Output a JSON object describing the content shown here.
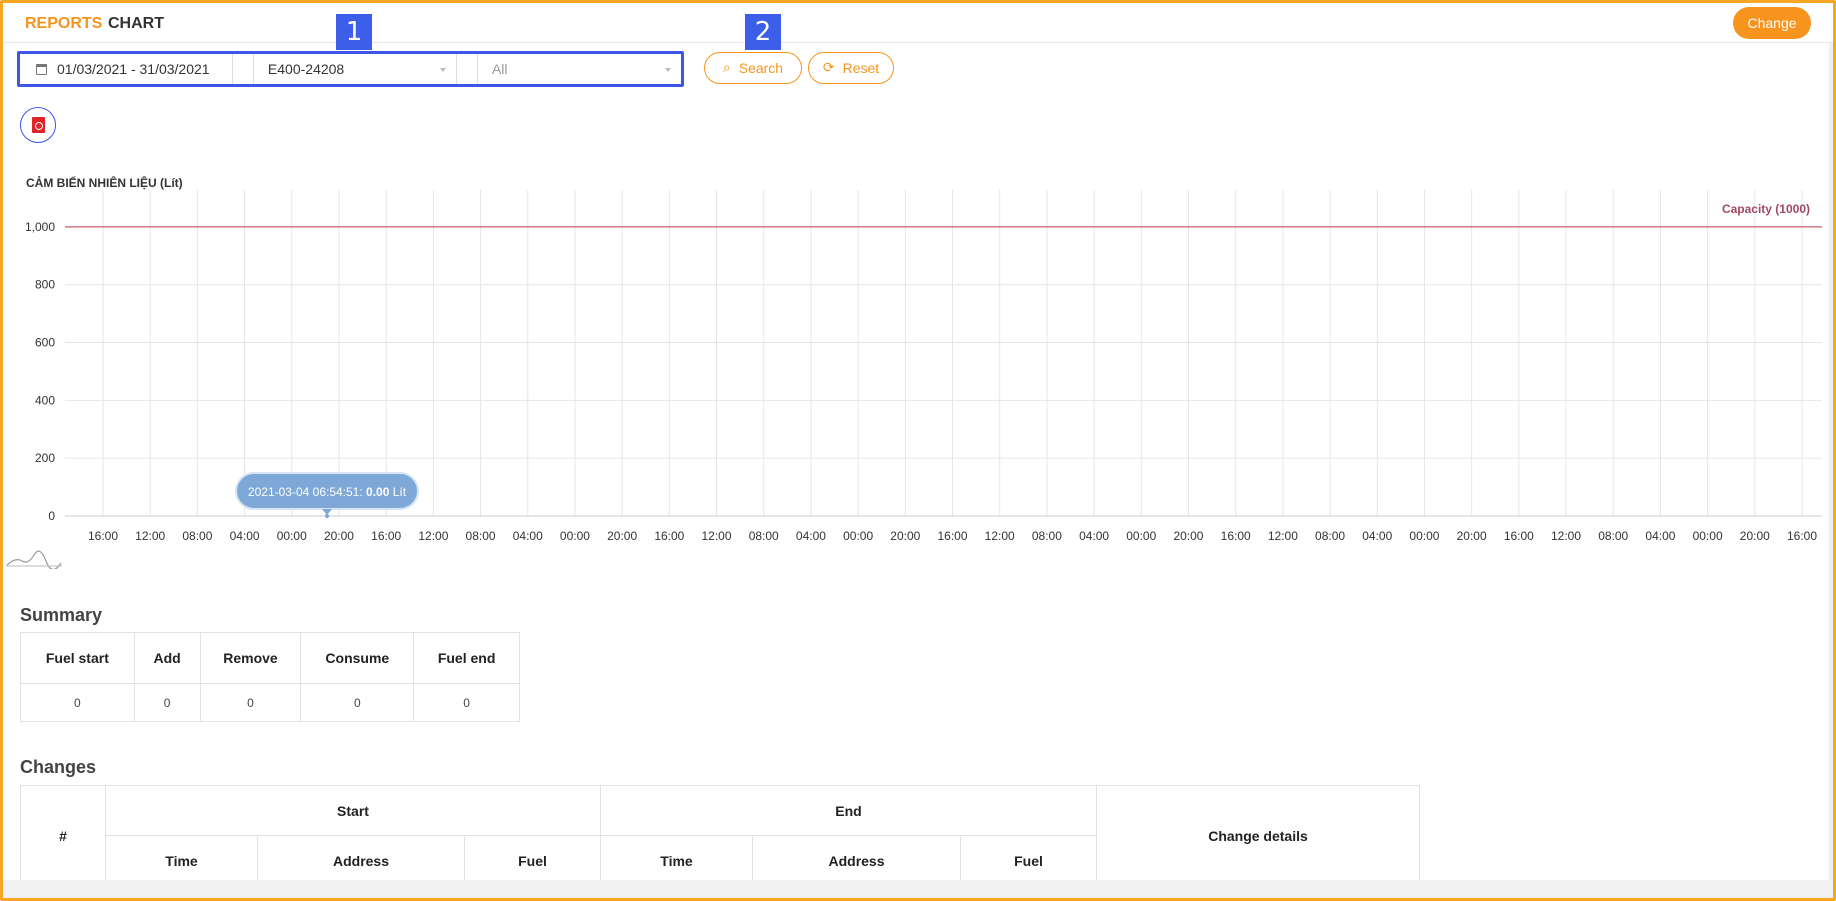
{
  "header": {
    "breadcrumb_reports": "REPORTS",
    "breadcrumb_chart": "CHART",
    "change_button": "Change"
  },
  "filters": {
    "date_range": "01/03/2021 - 31/03/2021",
    "vehicle": "E400-24208",
    "sensor": "All"
  },
  "markers": {
    "one": "1",
    "two": "2"
  },
  "actions": {
    "search": "Search",
    "reset": "Reset"
  },
  "chart_data": {
    "type": "line",
    "title": "CẢM BIẾN NHIÊN LIỆU (Lít)",
    "y_ticks": [
      "0",
      "200",
      "400",
      "600",
      "800",
      "1,000"
    ],
    "ylim": [
      0,
      1100
    ],
    "x_ticks": [
      "16:00",
      "12:00",
      "08:00",
      "04:00",
      "00:00",
      "20:00",
      "16:00",
      "12:00",
      "08:00",
      "04:00",
      "00:00",
      "20:00",
      "16:00",
      "12:00",
      "08:00",
      "04:00",
      "00:00",
      "20:00",
      "16:00",
      "12:00",
      "08:00",
      "04:00",
      "00:00",
      "20:00",
      "16:00",
      "12:00",
      "08:00",
      "04:00",
      "00:00",
      "20:00",
      "16:00",
      "12:00",
      "08:00",
      "04:00",
      "00:00",
      "20:00",
      "16:00"
    ],
    "capacity_line": {
      "label": "Capacity (1000)",
      "value": 1000,
      "color": "#c23a4f"
    },
    "series": [
      {
        "values": [
          0
        ]
      }
    ],
    "tooltip": {
      "time": "2021-03-04 06:54:51: ",
      "value": "0.00",
      "unit": " Lít"
    },
    "grid": true
  },
  "summary": {
    "title": "Summary",
    "headers": [
      "Fuel start",
      "Add",
      "Remove",
      "Consume",
      "Fuel end"
    ],
    "values": [
      "0",
      "0",
      "0",
      "0",
      "0"
    ]
  },
  "changes": {
    "title": "Changes",
    "col_number": "#",
    "group_start": "Start",
    "group_end": "End",
    "col_details": "Change details",
    "sub_headers": [
      "Time",
      "Address",
      "Fuel",
      "Time",
      "Address",
      "Fuel"
    ]
  },
  "colors": {
    "accent": "#f7941d",
    "marker": "#3d5ee8",
    "capacity": "#c23a4f",
    "tooltip_bg": "#7ea8d8"
  }
}
